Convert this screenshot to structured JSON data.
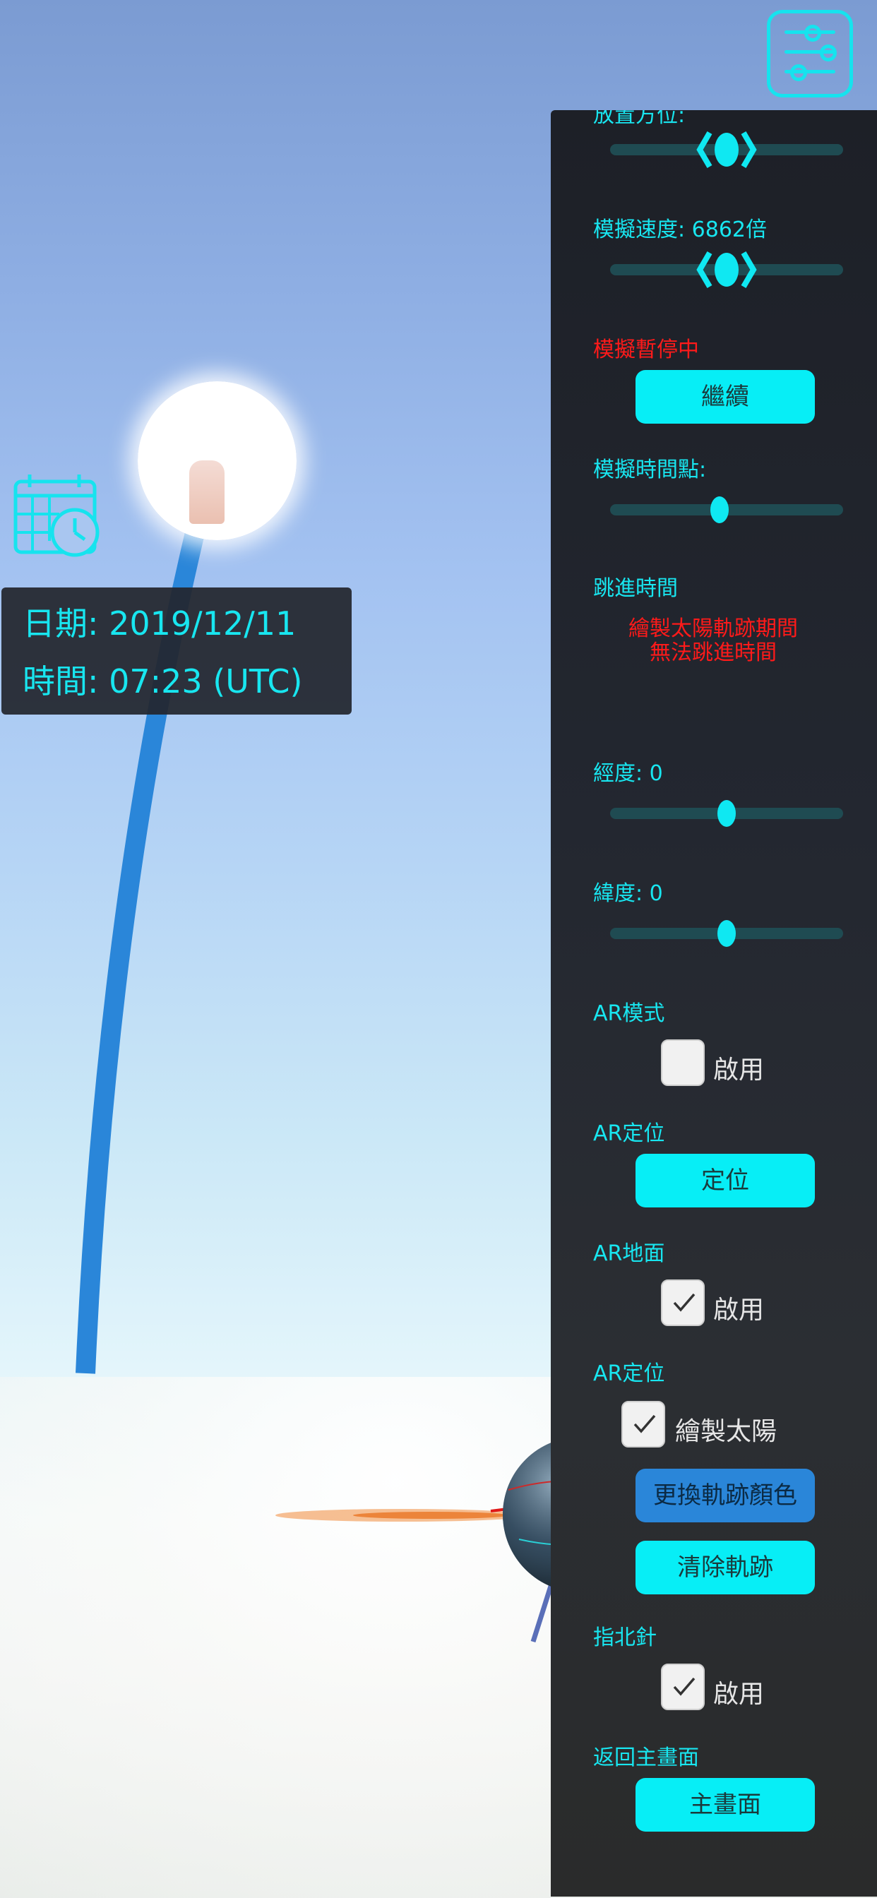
{
  "info": {
    "date_label": "日期: 2019/12/11",
    "time_label": "時間: 07:23 (UTC)"
  },
  "panel": {
    "placement_label": "放置方位:",
    "speed_label": "模擬速度: 6862倍",
    "paused_label": "模擬暫停中",
    "continue_button": "繼續",
    "timepoint_label": "模擬時間點:",
    "timepoint_value": 0.47,
    "jump_label": "跳進時間",
    "jump_notice_line1": "繪製太陽軌跡期間",
    "jump_notice_line2": "無法跳進時間",
    "longitude_label": "經度: 0",
    "longitude_value": 0.5,
    "latitude_label": "緯度: 0",
    "latitude_value": 0.5,
    "ar_mode_label": "AR模式",
    "ar_mode_checkbox": "啟用",
    "ar_mode_checked": false,
    "ar_locate_label": "AR定位",
    "locate_button": "定位",
    "ar_ground_label": "AR地面",
    "ar_ground_checkbox": "啟用",
    "ar_ground_checked": true,
    "ar_locate_label_2": "AR定位",
    "draw_sun_checkbox": "繪製太陽",
    "draw_sun_checked": true,
    "change_color_button": "更換軌跡顏色",
    "clear_track_button": "清除軌跡",
    "compass_label": "指北針",
    "compass_checkbox": "啟用",
    "compass_checked": true,
    "return_label": "返回主畫面",
    "main_button": "主畫面"
  },
  "colors": {
    "accent": "#18e6f0",
    "warning": "#ff1a1a",
    "track": "#2a86d9",
    "panel_bg": "#22262e"
  },
  "icons": {
    "settings": "sliders-icon",
    "calendar": "calendar-clock-icon"
  }
}
